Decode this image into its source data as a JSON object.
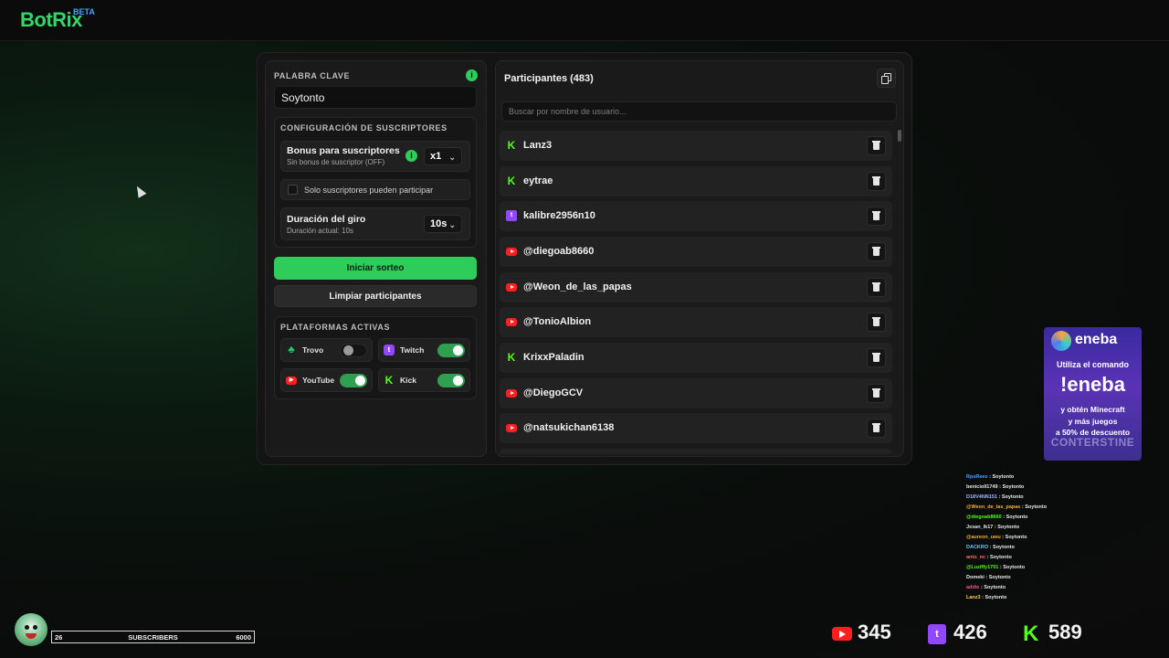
{
  "app": {
    "logo": "BotRix",
    "badge": "BETA"
  },
  "keyword": {
    "title": "PALABRA CLAVE",
    "value": "Soytonto",
    "info_icon": "info-icon"
  },
  "subscribers": {
    "title": "CONFIGURACIÓN DE SUSCRIPTORES",
    "bonus_label": "Bonus para suscriptores",
    "bonus_sub": "Sin bonus de suscriptor (OFF)",
    "bonus_value": "x1",
    "only_subs_label": "Solo suscriptores pueden participar",
    "only_subs_checked": false,
    "spin_label": "Duración del giro",
    "spin_sub": "Duración actual: 10s",
    "spin_value": "10s"
  },
  "buttons": {
    "start": "Iniciar sorteo",
    "clear": "Limpiar participantes"
  },
  "platforms": {
    "title": "PLATAFORMAS ACTIVAS",
    "items": [
      {
        "name": "Trovo",
        "enabled": false,
        "color": "#19d66b"
      },
      {
        "name": "Twitch",
        "enabled": true,
        "color": "#9146ff"
      },
      {
        "name": "YouTube",
        "enabled": true,
        "color": "#ff1f1f"
      },
      {
        "name": "Kick",
        "enabled": true,
        "color": "#53fc18"
      }
    ]
  },
  "participants": {
    "title": "Participantes (483)",
    "search_placeholder": "Buscar por nombre de usuario...",
    "items": [
      {
        "name": "Lanz3",
        "platform": "kick"
      },
      {
        "name": "eytrae",
        "platform": "kick"
      },
      {
        "name": "kalibre2956n10",
        "platform": "twitch"
      },
      {
        "name": "@diegoab8660",
        "platform": "youtube"
      },
      {
        "name": "@Weon_de_las_papas",
        "platform": "youtube"
      },
      {
        "name": "@TonioAlbion",
        "platform": "youtube"
      },
      {
        "name": "KrixxPaladin",
        "platform": "kick"
      },
      {
        "name": "@DiegoGCV",
        "platform": "youtube"
      },
      {
        "name": "@natsukichan6138",
        "platform": "youtube"
      }
    ]
  },
  "promo": {
    "brand": "eneba",
    "line1": "Utiliza el comando",
    "command": "!eneba",
    "line2a": "y obtén Minecraft",
    "line2b": "y más juegos",
    "line2c": "a 50% de descuento",
    "streamer": "CONTERSTINE"
  },
  "chat": [
    {
      "user": "RpsReee",
      "msg": "Soytonto",
      "color": "#4aa3ff"
    },
    {
      "user": "benicio91749",
      "msg": "Soytonto",
      "color": "#e6e6e6"
    },
    {
      "user": "D18V4NN151",
      "msg": "Soytonto",
      "color": "#9bb7ff"
    },
    {
      "user": "@Weon_de_las_papas",
      "msg": "Soytonto",
      "color": "#f2b134"
    },
    {
      "user": "@diegoab8660",
      "msg": "Soytonto",
      "color": "#53fc18"
    },
    {
      "user": "Jxxan_lk17",
      "msg": "Soytonto",
      "color": "#e6e6e6"
    },
    {
      "user": "@aureon_uwu",
      "msg": "Soytonto",
      "color": "#f2b134"
    },
    {
      "user": "DACKRO",
      "msg": "Soytonto",
      "color": "#6ec6ff"
    },
    {
      "user": "anto_nc",
      "msg": "Soytonto",
      "color": "#ff6b6b"
    },
    {
      "user": "@Luziffy1701",
      "msg": "Soytonto",
      "color": "#53fc18"
    },
    {
      "user": "Domeki",
      "msg": "Soytonto",
      "color": "#e6e6e6"
    },
    {
      "user": "addie",
      "msg": "Soytonto",
      "color": "#ff4d8d"
    },
    {
      "user": "Lanz3",
      "msg": "Soytonto",
      "color": "#ffd24a"
    }
  ],
  "subgoal": {
    "current": "26",
    "label": "SUBSCRIBERS",
    "goal": "6000"
  },
  "counters": {
    "youtube": "345",
    "twitch": "426",
    "kick": "589"
  }
}
